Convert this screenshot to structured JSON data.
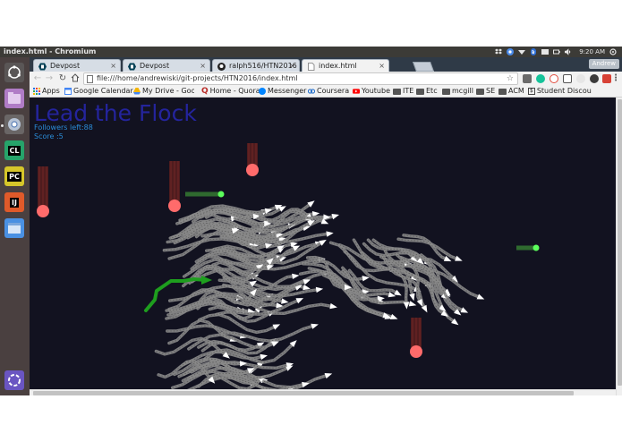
{
  "window": {
    "title": "index.html - Chromium",
    "clock": "9:20 AM"
  },
  "launcher": {
    "items": [
      "dash-home",
      "files",
      "chromium",
      "clion",
      "pycharm",
      "intellij",
      "workspaces",
      "trash"
    ],
    "labels": {
      "clion": "CL",
      "pycharm": "PC",
      "intellij": "IJ"
    }
  },
  "tabs": [
    {
      "label": "Devpost",
      "icon": "devpost-icon",
      "active": false
    },
    {
      "label": "Devpost",
      "icon": "devpost-icon",
      "active": false
    },
    {
      "label": "ralph516/HTN2016",
      "icon": "github-icon",
      "active": false
    },
    {
      "label": "index.html",
      "icon": "page-icon",
      "active": true
    }
  ],
  "tab_close_glyph": "×",
  "profile": "Andrew",
  "address": {
    "url": "file:///home/andrewiski/git-projects/HTN2016/index.html"
  },
  "bookmarks": [
    {
      "label": "Apps",
      "icon": "apps-grid-icon",
      "color": "#1a73e8"
    },
    {
      "label": "Google Calendar",
      "icon": "calendar-icon",
      "color": "#4285f4"
    },
    {
      "label": "My Drive - Google",
      "icon": "drive-icon",
      "color": "#f4b400"
    },
    {
      "label": "Home - Quora",
      "icon": "quora-icon",
      "color": "#b92b27"
    },
    {
      "label": "Messenger",
      "icon": "messenger-icon",
      "color": "#0084ff"
    },
    {
      "label": "Coursera",
      "icon": "coursera-icon",
      "color": "#2a73cc"
    },
    {
      "label": "Youtube",
      "icon": "youtube-icon",
      "color": "#ff0000"
    },
    {
      "label": "ITE",
      "icon": "folder-icon",
      "color": "#555555"
    },
    {
      "label": "Etc",
      "icon": "folder-icon",
      "color": "#555555"
    },
    {
      "label": "mcgill",
      "icon": "folder-icon",
      "color": "#555555"
    },
    {
      "label": "SE",
      "icon": "folder-icon",
      "color": "#555555"
    },
    {
      "label": "ACM",
      "icon": "folder-icon",
      "color": "#555555"
    },
    {
      "label": "Student Discou",
      "icon": "student-discount-icon",
      "color": "#444444"
    }
  ],
  "game": {
    "title": "Lead the Flock",
    "followers_label": "Followers left:",
    "followers_value": "88",
    "score_label": "Score :",
    "score_value": "5",
    "colors": {
      "background": "#121220",
      "title": "#24249c",
      "hud": "#2a8bd6",
      "trail": "#8a8a8a",
      "flock_arrow": "#ffffff",
      "leader": "#1e9e1e",
      "predator": "#ff6b6b",
      "predator_trail": "#5a1e1e",
      "food": "#5cff5c",
      "food_trail": "#2f6a2f"
    }
  }
}
